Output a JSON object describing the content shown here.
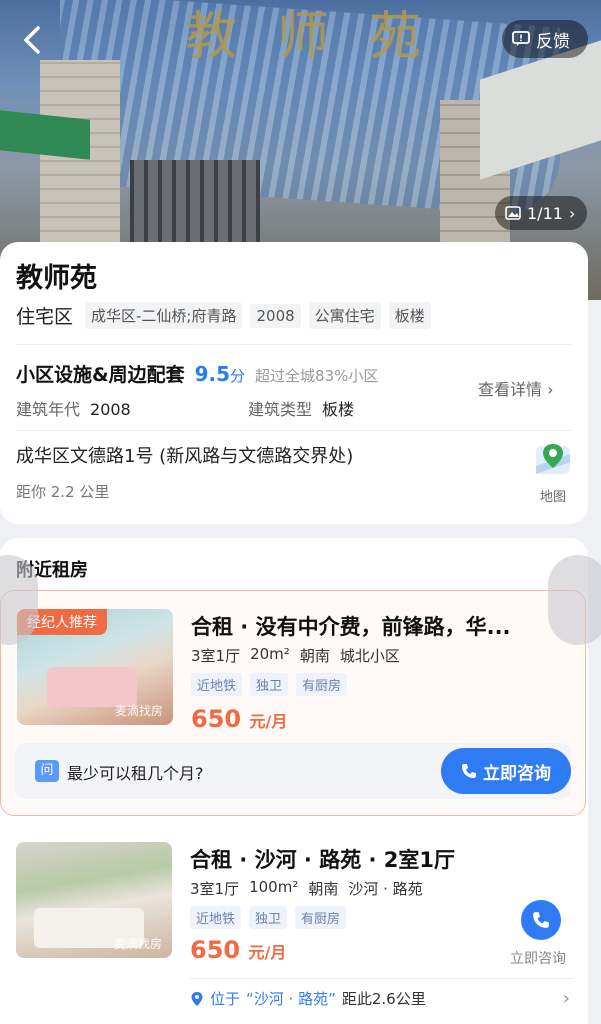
{
  "hero": {
    "sign_text": "教师苑",
    "feedback_label": "反馈",
    "photo_counter": "1/11"
  },
  "community": {
    "name": "教师苑",
    "subtype": "住宅区",
    "tags": [
      "成华区-二仙桥;府青路",
      "2008",
      "公寓住宅",
      "板楼"
    ],
    "facilities_label": "小区设施&周边配套",
    "score": "9.5",
    "score_unit": "分",
    "score_note": "超过全城83%小区",
    "detail_link": "查看详情",
    "build_year_label": "建筑年代",
    "build_year": "2008",
    "build_type_label": "建筑类型",
    "build_type": "板楼",
    "address": "成华区文德路1号 (新风路与文德路交界处)",
    "distance": "距你 2.2 公里",
    "map_label": "地图"
  },
  "nearby": {
    "section_title": "附近租房",
    "listings": [
      {
        "badge": "经纪人推荐",
        "watermark": "麦滴找房",
        "title": "合租 · 没有中介费，前锋路，华...",
        "meta": [
          "3室1厅",
          "20m²",
          "朝南",
          "城北小区"
        ],
        "tags": [
          "近地铁",
          "独卫",
          "有厨房"
        ],
        "price": "650",
        "price_unit": "元/月",
        "qa_icon": "问",
        "qa_text": "最少可以租几个月?",
        "consult_label": "立即咨询"
      },
      {
        "watermark": "麦滴找房",
        "title": "合租 · 沙河 · 路苑 · 2室1厅",
        "meta": [
          "3室1厅",
          "100m²",
          "朝南",
          "沙河 · 路苑"
        ],
        "tags": [
          "近地铁",
          "独卫",
          "有厨房"
        ],
        "price": "650",
        "price_unit": "元/月",
        "consult_label": "立即咨询",
        "location_prefix": "位于",
        "location_name": "“沙河 · 路苑”",
        "location_suffix": "距此2.6公里"
      }
    ]
  },
  "colors": {
    "accent_blue": "#2f7bf3",
    "price_orange": "#f06a43",
    "badge_orange": "#f06a43"
  },
  "icons": [
    "back-icon",
    "feedback-icon",
    "image-icon",
    "chevron-right-icon",
    "map-pin-icon",
    "phone-icon",
    "location-icon"
  ]
}
